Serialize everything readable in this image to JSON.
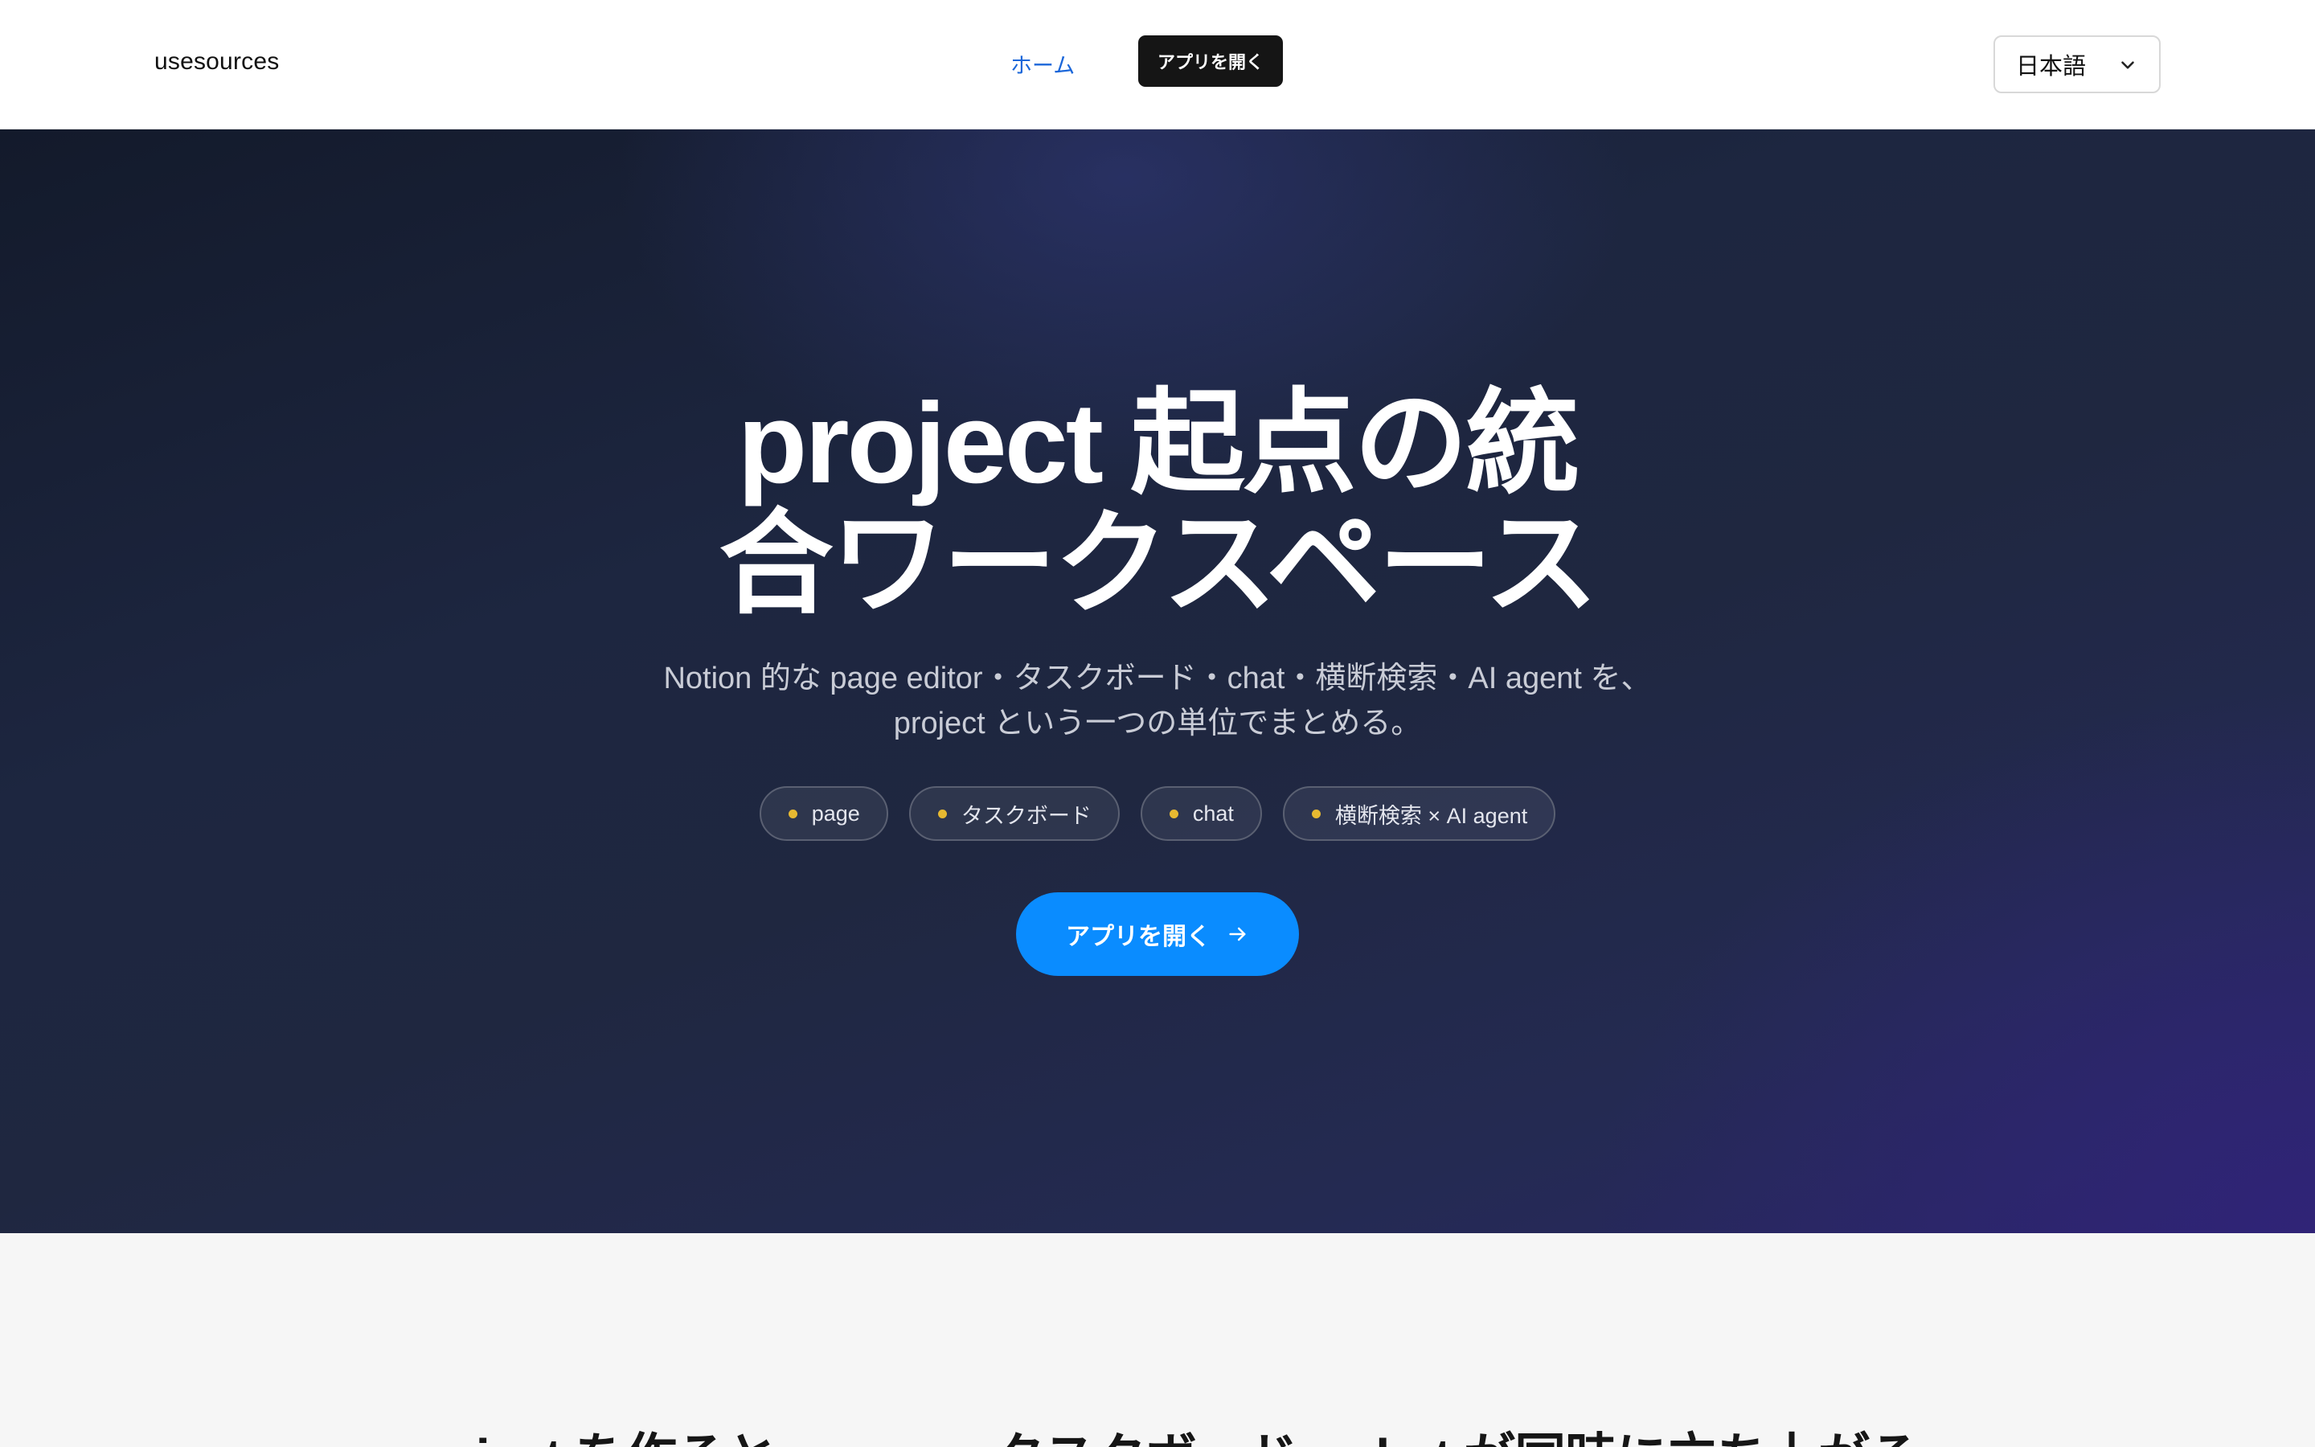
{
  "header": {
    "logo": "usesources",
    "nav_home": "ホーム",
    "nav_open_app": "アプリを開く",
    "language": "日本語"
  },
  "hero": {
    "title_line1": "project 起点の統",
    "title_line2": "合ワークスペース",
    "subtitle_line1": "Notion 的な page editor・タスクボード・chat・横断検索・AI agent を、",
    "subtitle_line2": "project という一つの単位でまとめる。",
    "pills": [
      {
        "label": "page"
      },
      {
        "label": "タスクボード"
      },
      {
        "label": "chat"
      },
      {
        "label": "横断検索 × AI agent"
      }
    ],
    "cta_label": "アプリを開く"
  },
  "section2": {
    "title": "project を作ると、page・タスクボード・chat が同時に立ち上がる"
  },
  "colors": {
    "accent": "#0a8cff",
    "nav_link": "#1a66d9",
    "pill_dot": "#e7b931"
  },
  "icons": {
    "language_dropdown": "chevron-down-icon",
    "cta": "arrow-right-icon"
  }
}
